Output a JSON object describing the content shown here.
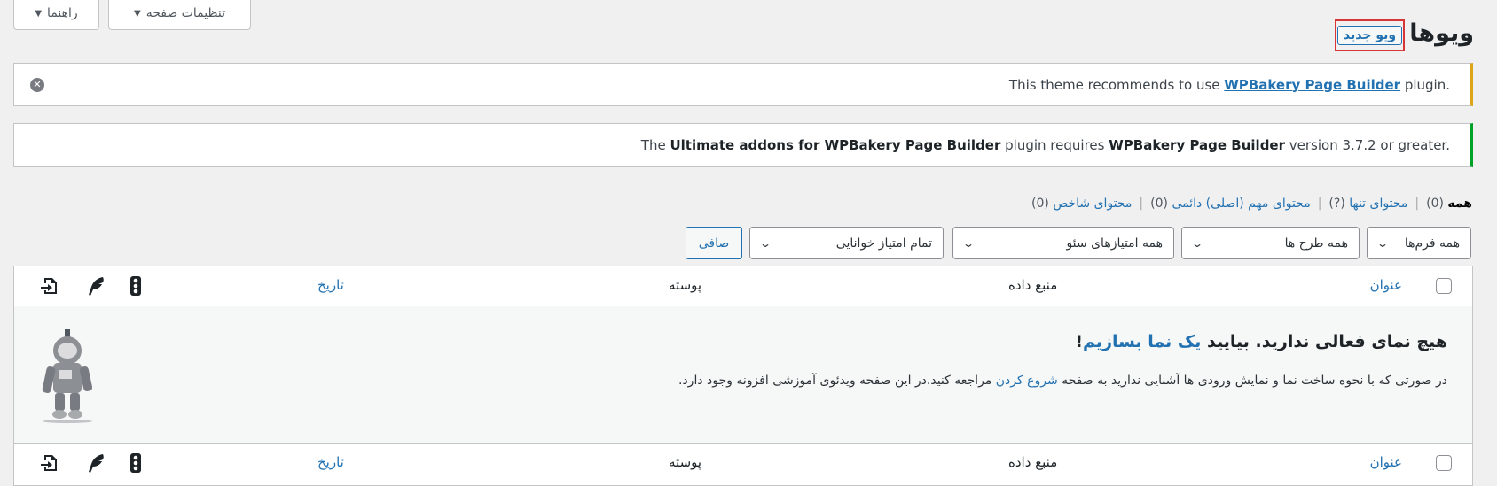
{
  "screen_meta": {
    "screen_options_label": "تنظیمات صفحه",
    "help_label": "راهنما",
    "caret": "▼"
  },
  "header": {
    "title": "ویوها",
    "add_new_label": "ویو جدید"
  },
  "notices": {
    "warning": {
      "prefix": "This theme recommends to use ",
      "link": "WPBakery Page Builder",
      "suffix": " plugin."
    },
    "error_success": {
      "t1": "The ",
      "b1": "Ultimate addons for WPBakery Page Builder",
      "t2": " plugin requires ",
      "b2": "WPBakery Page Builder",
      "t3": " version 3.7.2 or greater."
    }
  },
  "views": [
    {
      "label": "همه",
      "count": "(0)"
    },
    {
      "label": "محتوای تنها",
      "count": "(?)"
    },
    {
      "label": "محتوای مهم (اصلی) دائمی",
      "count": "(0)"
    },
    {
      "label": "محتوای شاخص",
      "count": "(0)"
    }
  ],
  "filters": {
    "formats": "همه فرم‌ها",
    "layouts": "همه طرح ها",
    "seo_scores": "همه امتیازهای سئو",
    "readability": "تمام امتیاز خوانایی",
    "filter_button": "صافی"
  },
  "table": {
    "columns": {
      "title": "عنوان",
      "source": "منبع داده",
      "post": "پوسته",
      "date": "تاریخ"
    },
    "empty": {
      "heading_plain": "هیچ نمای فعالی ندارید. بیایید ",
      "heading_link": "یک نما بسازیم",
      "heading_end": "!",
      "desc_plain1": "در صورتی که با نحوه ساخت نما و نمایش ورودی ها آشنایی ندارید به صفحه ",
      "desc_link": "شروع کردن",
      "desc_plain2": " مراجعه کنید.در این صفحه ویدئوی آموزشی افزونه وجود دارد."
    }
  }
}
